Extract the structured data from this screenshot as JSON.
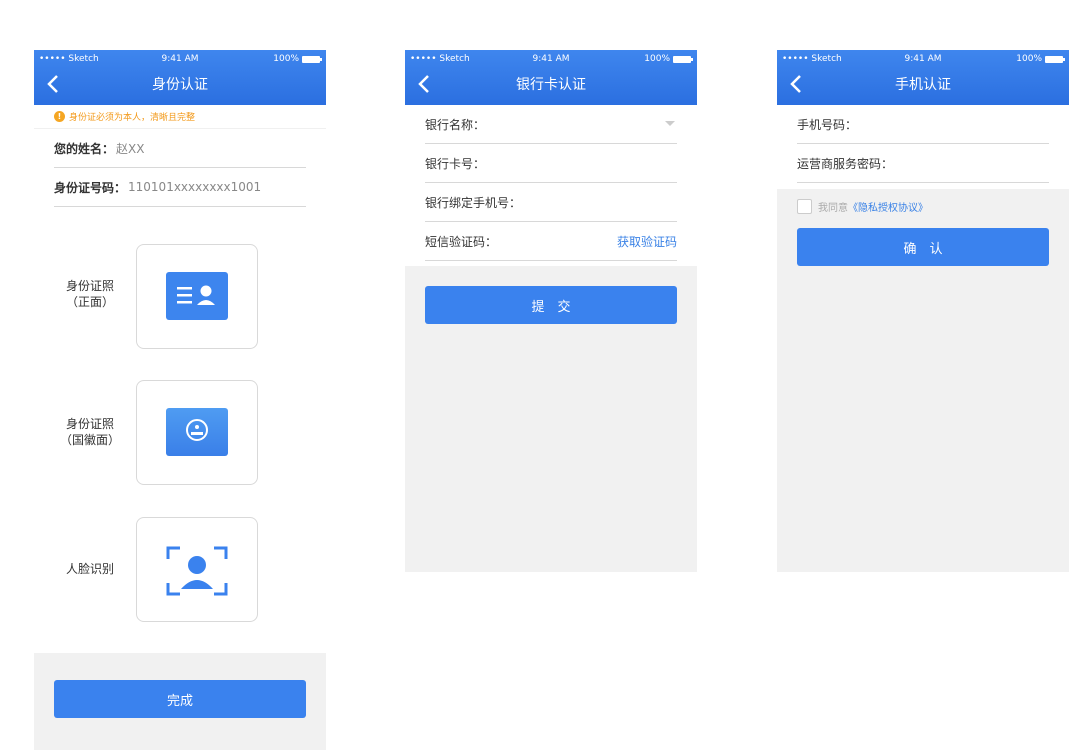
{
  "status": {
    "carrier": "••••• Sketch",
    "time": "9:41 AM",
    "battery": "100%"
  },
  "screens": [
    {
      "title": "身份认证",
      "notice": "身份证必须为本人，清晰且完整",
      "fields": [
        {
          "label": "您的姓名：",
          "value": "赵XX"
        },
        {
          "label": "身份证号码：",
          "value": "110101xxxxxxxx1001"
        }
      ],
      "uploads": [
        {
          "line1": "身份证照",
          "line2": "（正面）",
          "icon": "id-card-front-icon"
        },
        {
          "line1": "身份证照",
          "line2": "（国徽面）",
          "icon": "national-emblem-icon"
        },
        {
          "line1": "人脸识别",
          "line2": "",
          "icon": "face-scan-icon"
        }
      ],
      "button": "完成"
    },
    {
      "title": "银行卡认证",
      "fields": [
        {
          "label": "银行名称："
        },
        {
          "label": "银行卡号："
        },
        {
          "label": "银行绑定手机号："
        },
        {
          "label": "短信验证码：",
          "action": "获取验证码"
        }
      ],
      "button": "提　交"
    },
    {
      "title": "手机认证",
      "fields": [
        {
          "label": "手机号码："
        },
        {
          "label": "运营商服务密码："
        }
      ],
      "agree_prefix": "我同意",
      "agree_link": "《隐私授权协议》",
      "button": "确　认"
    }
  ],
  "colors": {
    "primary": "#3a82ee",
    "warning": "#f5a623",
    "background_gray": "#f1f1f1"
  }
}
